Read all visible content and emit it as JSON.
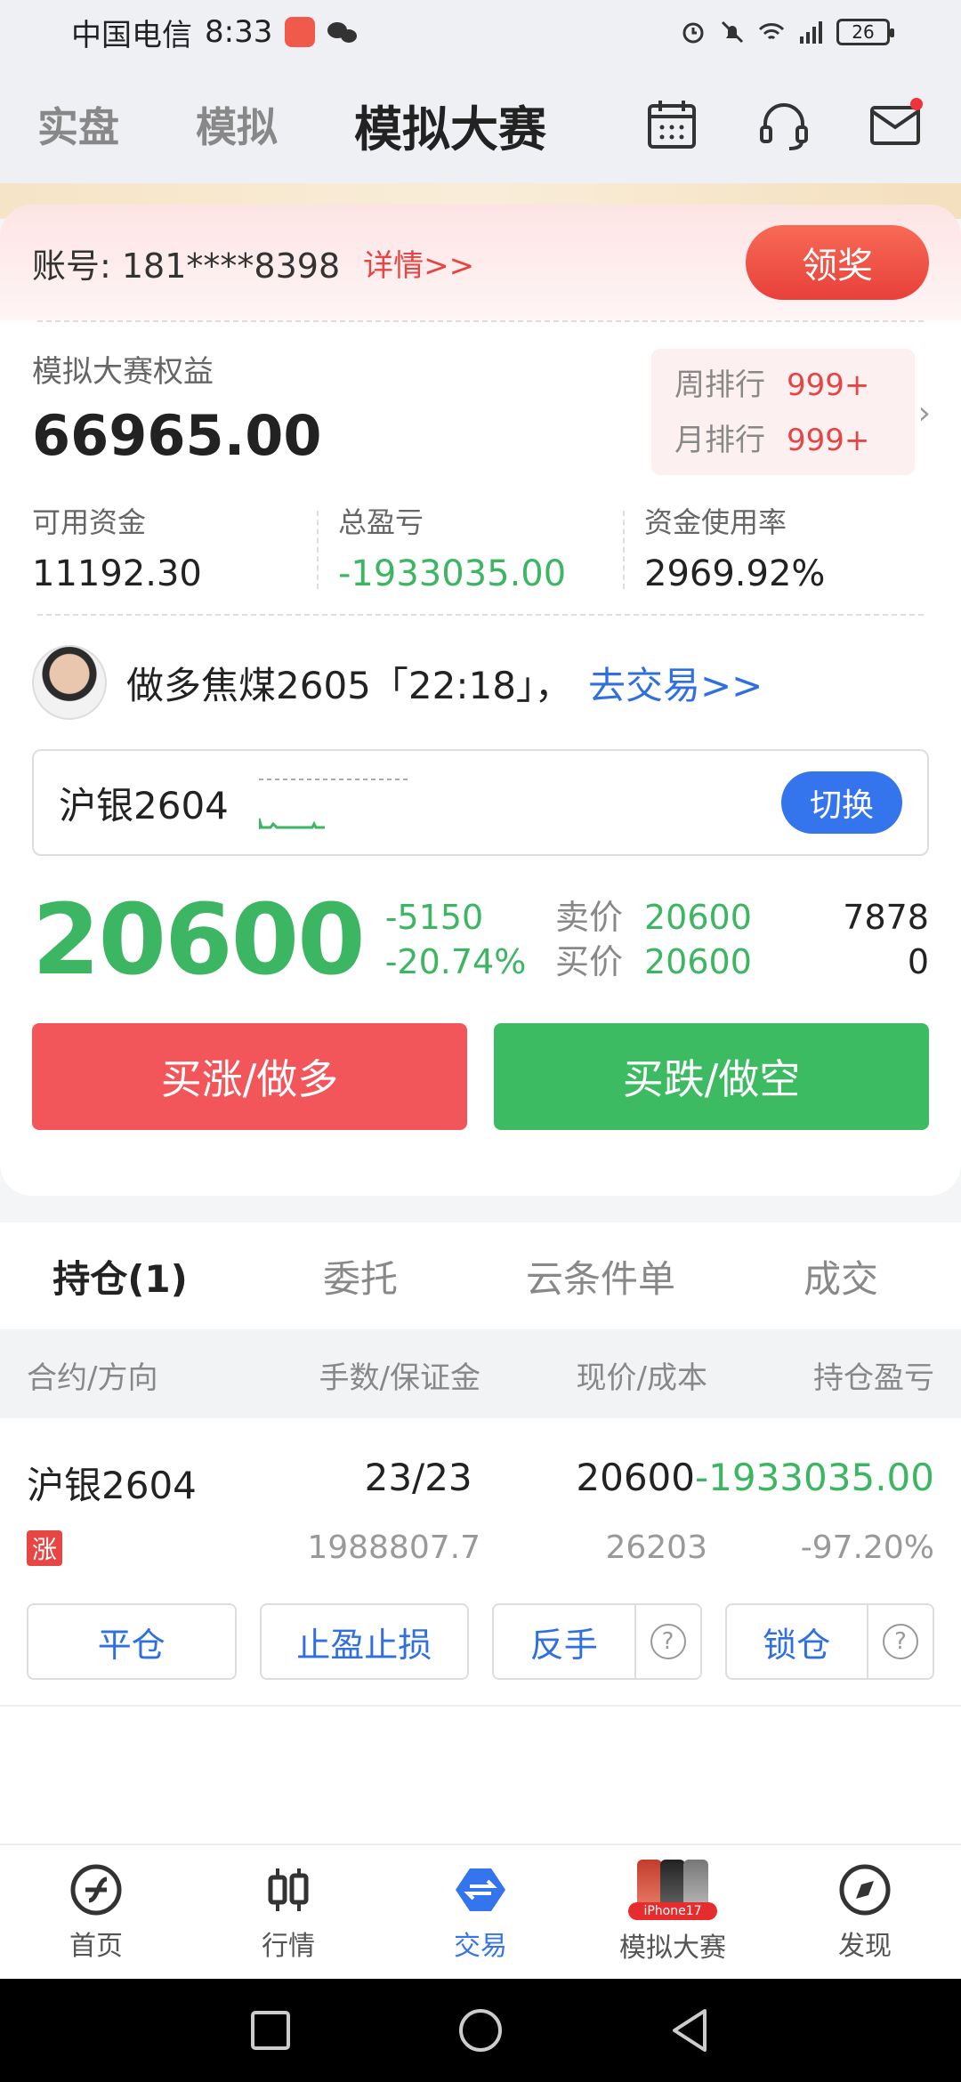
{
  "status_bar": {
    "carrier": "中国电信",
    "time": "8:33",
    "battery": "26"
  },
  "top_nav": {
    "tabs": [
      "实盘",
      "模拟",
      "模拟大赛"
    ]
  },
  "account": {
    "label": "账号: 181****8398",
    "detail_link": "详情>>",
    "prize_button": "领奖"
  },
  "equity": {
    "title": "模拟大赛权益",
    "value": "66965.00",
    "rank_week_label": "周排行",
    "rank_week": "999+",
    "rank_month_label": "月排行",
    "rank_month": "999+"
  },
  "stats": [
    {
      "label": "可用资金",
      "value": "11192.30"
    },
    {
      "label": "总盈亏",
      "value": "-1933035.00"
    },
    {
      "label": "资金使用率",
      "value": "2969.92%"
    }
  ],
  "promo": {
    "text": "做多焦煤2605「22:18」，",
    "link": "去交易>>"
  },
  "instrument": {
    "name": "沪银2604",
    "switch_label": "切换"
  },
  "quote": {
    "price": "20600",
    "change": "-5150",
    "change_pct": "-20.74%",
    "ask_label": "卖价",
    "ask": "20600",
    "ask_qty": "7878",
    "bid_label": "买价",
    "bid": "20600",
    "bid_qty": "0"
  },
  "trade_buttons": {
    "buy_long": "买涨/做多",
    "sell_short": "买跌/做空"
  },
  "position_tabs": [
    "持仓(1)",
    "委托",
    "云条件单",
    "成交"
  ],
  "table_headers": [
    "合约/方向",
    "手数/保证金",
    "现价/成本",
    "持仓盈亏"
  ],
  "position": {
    "contract": "沪银2604",
    "direction_tag": "涨",
    "lots": "23/23",
    "margin": "1988807.7",
    "price": "20600",
    "cost": "26203",
    "pnl": "-1933035.00",
    "pnl_pct": "-97.20%"
  },
  "position_actions": {
    "close": "平仓",
    "tp_sl": "止盈止损",
    "reverse": "反手",
    "lock": "锁仓",
    "help": "?"
  },
  "bottom_nav": [
    {
      "label": "首页",
      "icon": "home-icon"
    },
    {
      "label": "行情",
      "icon": "candlestick-icon"
    },
    {
      "label": "交易",
      "icon": "trade-icon"
    },
    {
      "label": "模拟大赛",
      "icon": "iphone-promo-icon",
      "badge": "iPhone17"
    },
    {
      "label": "发现",
      "icon": "compass-icon"
    }
  ],
  "colors": {
    "accent": "#3474ec",
    "up": "#f2555a",
    "down": "#3dbb62",
    "warn": "#e54545"
  }
}
